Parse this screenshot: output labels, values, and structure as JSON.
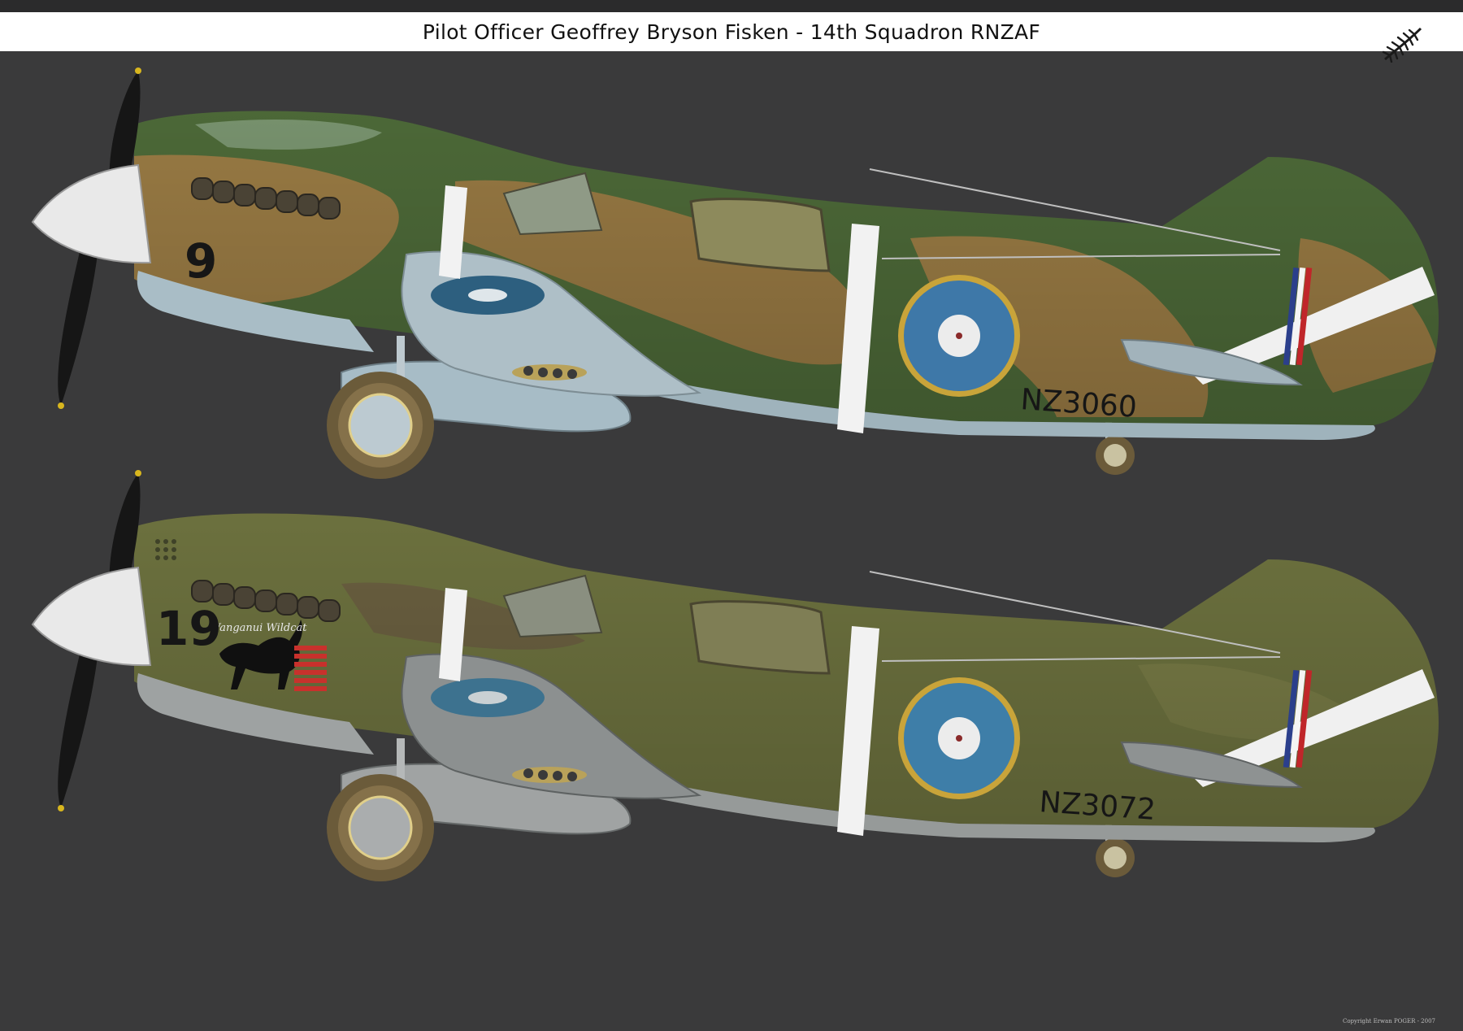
{
  "header": {
    "title": "Pilot Officer Geoffrey Bryson Fisken - 14th Squadron RNZAF"
  },
  "aircraft": [
    {
      "id": "upper",
      "serial": "NZ3060",
      "code": "9",
      "nose_art_text": ""
    },
    {
      "id": "lower",
      "serial": "NZ3072",
      "code": "19",
      "nose_art_text": "Wanganui Wildcat"
    }
  ],
  "footer": {
    "copyright": "Copyright Erwan POGER - 2007"
  },
  "colors": {
    "background": "#3a3a3b",
    "title_strip": "#ffffff",
    "camo_green": "#4c6a38",
    "camo_tan": "#9c7d45",
    "olive_drab": "#6f7440",
    "underside_blue": "#a9bdc6",
    "roundel_blue": "#3e78a8",
    "roundel_yellow": "#c9a43a",
    "id_band_white": "#f2f2f2"
  },
  "icons": {
    "logo": "silver-fern-icon",
    "aircraft": "p40-kittyhawk-profile"
  }
}
